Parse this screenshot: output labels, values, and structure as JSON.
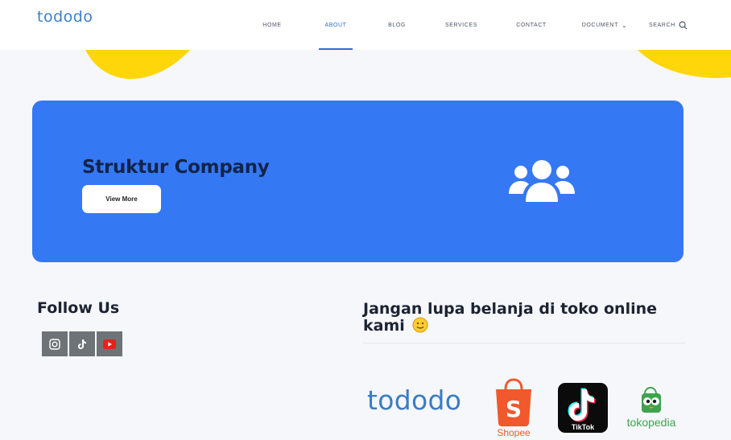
{
  "header": {
    "logo_text": "tododo",
    "nav": [
      {
        "label": "HOME",
        "active": false
      },
      {
        "label": "ABOUT",
        "active": true
      },
      {
        "label": "BLOG",
        "active": false
      },
      {
        "label": "SERVICES",
        "active": false
      },
      {
        "label": "CONTACT",
        "active": false
      },
      {
        "label": "DOCUMENT",
        "active": false
      }
    ],
    "search_label": "SEARCH"
  },
  "banner": {
    "title": "Struktur Company",
    "button_label": "View More",
    "icon": "users-group-icon"
  },
  "follow": {
    "title": "Follow Us",
    "icons": [
      "instagram-icon",
      "tiktok-icon",
      "youtube-icon"
    ]
  },
  "shop": {
    "title": "Jangan lupa belanja di toko online kami",
    "emoji": "smiley-emoji",
    "stores": {
      "todo": "tododo",
      "shopee": "Shopee",
      "tiktok": "TikTok",
      "tokopedia": "tokopedia"
    }
  },
  "colors": {
    "accent": "#3578f4",
    "banner_title": "#13244a",
    "yellow": "#ffd60a",
    "social_bg": "#6e7378"
  }
}
